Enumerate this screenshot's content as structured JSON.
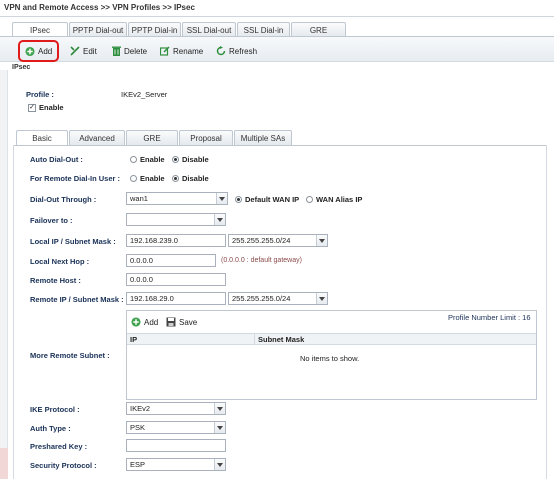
{
  "breadcrumb": "VPN and Remote Access >> VPN Profiles >> IPsec",
  "top_tabs": [
    {
      "label": "IPsec",
      "active": true
    },
    {
      "label": "PPTP Dial-out",
      "active": false
    },
    {
      "label": "PPTP Dial-in",
      "active": false
    },
    {
      "label": "SSL Dial-out",
      "active": false
    },
    {
      "label": "SSL Dial-in",
      "active": false
    },
    {
      "label": "GRE",
      "active": false
    }
  ],
  "toolbar": {
    "add": "Add",
    "add_icon": "add-icon",
    "edit": "Edit",
    "edit_icon": "edit-icon",
    "delete": "Delete",
    "delete_icon": "trash-icon",
    "rename": "Rename",
    "rename_icon": "rename-icon",
    "refresh": "Refresh",
    "refresh_icon": "refresh-icon",
    "highlight_color": "#e01b1b"
  },
  "section_title": "IPsec",
  "profile": {
    "label": "Profile :",
    "value": "IKEv2_Server"
  },
  "enable": {
    "label": "Enable",
    "checked": true
  },
  "inner_tabs": [
    {
      "label": "Basic",
      "active": true
    },
    {
      "label": "Advanced",
      "active": false
    },
    {
      "label": "GRE",
      "active": false
    },
    {
      "label": "Proposal",
      "active": false
    },
    {
      "label": "Multiple SAs",
      "active": false
    }
  ],
  "form": {
    "auto_dial_out": {
      "label": "Auto Dial-Out :",
      "options": [
        "Enable",
        "Disable"
      ],
      "selected": "Disable"
    },
    "remote_dial_in": {
      "label": "For Remote Dial-In User :",
      "options": [
        "Enable",
        "Disable"
      ],
      "selected": "Disable"
    },
    "dial_out_through": {
      "label": "Dial-Out Through :",
      "value": "wan1",
      "options": [
        "Default WAN IP",
        "WAN Alias IP"
      ],
      "selected": "Default WAN IP"
    },
    "failover_to": {
      "label": "Failover to :",
      "value": ""
    },
    "local_ip": {
      "label": "Local IP / Subnet Mask :",
      "ip": "192.168.239.0",
      "mask": "255.255.255.0/24"
    },
    "local_next_hop": {
      "label": "Local Next Hop :",
      "value": "0.0.0.0",
      "hint": "(0.0.0.0 : default gateway)"
    },
    "remote_host": {
      "label": "Remote Host :",
      "value": "0.0.0.0"
    },
    "remote_ip": {
      "label": "Remote IP / Subnet Mask :",
      "ip": "192.168.29.0",
      "mask": "255.255.255.0/24"
    },
    "more_remote_subnet": {
      "label": "More Remote Subnet :",
      "add": "Add",
      "add_icon": "add-icon",
      "save": "Save",
      "save_icon": "save-icon",
      "limit": "Profile Number Limit : 16",
      "columns": [
        "IP",
        "Subnet Mask"
      ],
      "empty": "No items to show."
    },
    "ike_protocol": {
      "label": "IKE Protocol :",
      "value": "IKEv2"
    },
    "auth_type": {
      "label": "Auth Type :",
      "value": "PSK"
    },
    "preshared_key": {
      "label": "Preshared Key :",
      "value": ""
    },
    "security_protocol": {
      "label": "Security Protocol :",
      "value": "ESP"
    }
  }
}
